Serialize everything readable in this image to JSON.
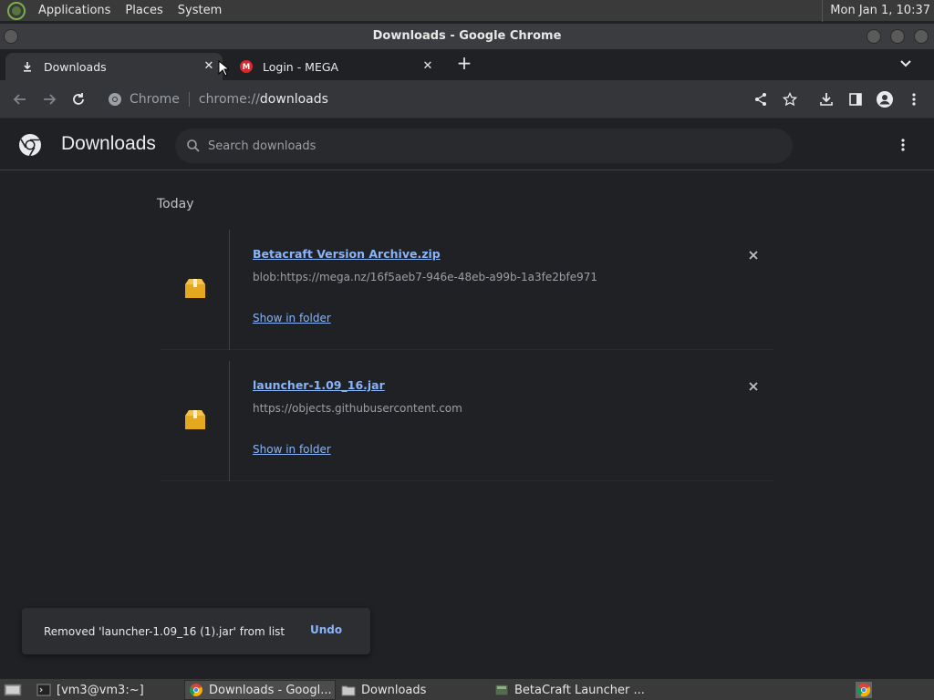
{
  "panel": {
    "menus": [
      "Applications",
      "Places",
      "System"
    ],
    "clock": "Mon Jan 1, 10:37"
  },
  "window": {
    "title": "Downloads - Google Chrome"
  },
  "tabs": [
    {
      "label": "Downloads",
      "icon": "download-icon"
    },
    {
      "label": "Login - MEGA",
      "icon": "mega-icon"
    }
  ],
  "omnibox": {
    "chip": "Chrome",
    "url_prefix": "chrome://",
    "url_path": "downloads"
  },
  "downloads": {
    "title": "Downloads",
    "search_placeholder": "Search downloads",
    "date_group": "Today",
    "items": [
      {
        "name": "Betacraft Version Archive.zip",
        "url": "blob:https://mega.nz/16f5aeb7-946e-48eb-a99b-1a3fe2bfe971",
        "action": "Show in folder"
      },
      {
        "name": "launcher-1.09_16.jar",
        "url": "https://objects.githubusercontent.com",
        "action": "Show in folder"
      }
    ]
  },
  "toast": {
    "message": "Removed 'launcher-1.09_16 (1).jar' from list",
    "action": "Undo"
  },
  "taskbar": {
    "items": [
      {
        "label": "[vm3@vm3:~]",
        "icon": "terminal-icon"
      },
      {
        "label": "Downloads - Googl...",
        "icon": "chrome-icon"
      },
      {
        "label": "Downloads",
        "icon": "folder-icon"
      },
      {
        "label": "BetaCraft Launcher ...",
        "icon": "java-icon"
      }
    ]
  },
  "colors": {
    "link": "#8ab4f8",
    "background": "#202124",
    "surface": "#35363a"
  }
}
